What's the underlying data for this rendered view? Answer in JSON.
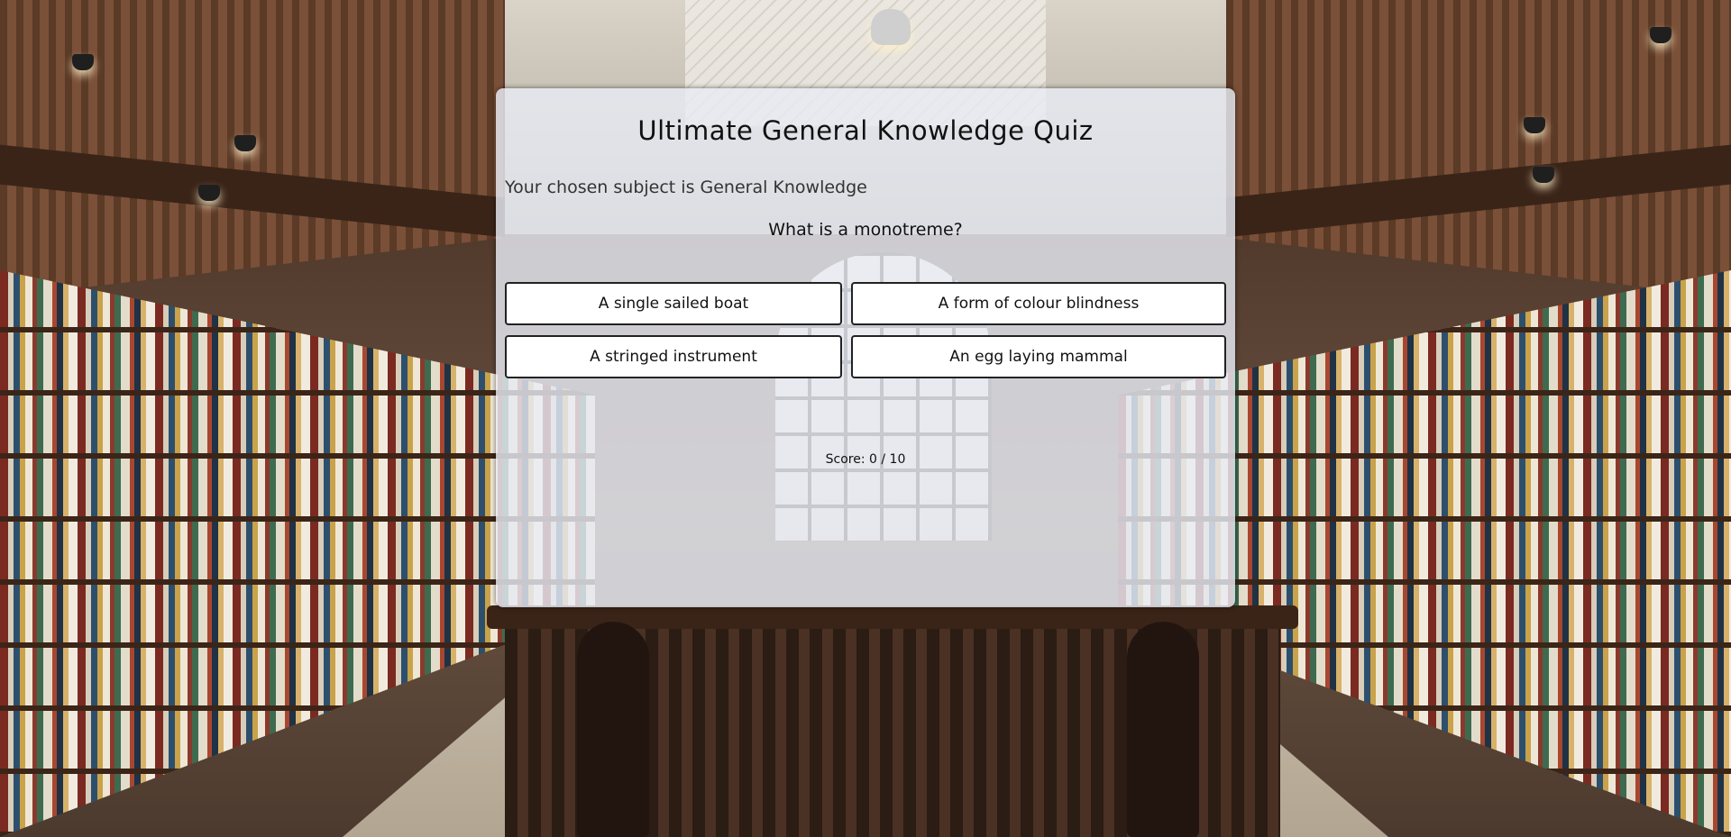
{
  "quiz": {
    "title": "Ultimate General Knowledge Quiz",
    "subject_text": "Your chosen subject is General Knowledge",
    "question": "What is a monotreme?",
    "answers": [
      "A single sailed boat",
      "A form of colour blindness",
      "A stringed instrument",
      "An egg laying mammal"
    ],
    "score_text": "Score: 0 / 10"
  },
  "colors": {
    "card_background": "#e8ecf4",
    "button_background": "#ffffff",
    "button_border": "#222222",
    "text": "#111111"
  }
}
